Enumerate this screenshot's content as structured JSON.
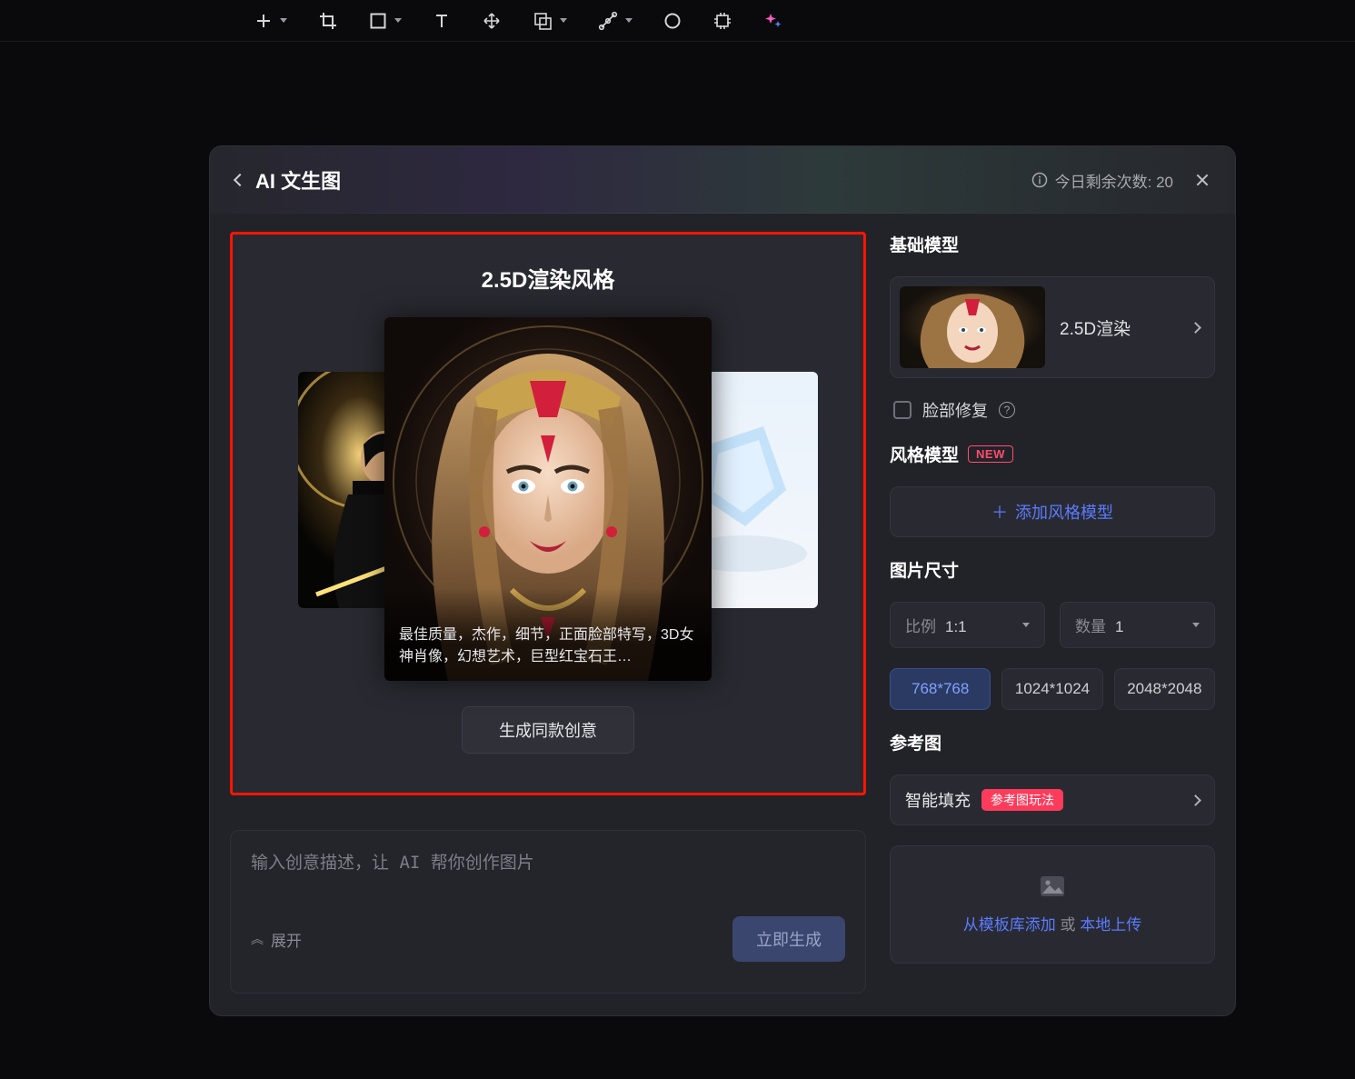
{
  "header": {
    "title": "AI 文生图",
    "quota": "今日剩余次数: 20"
  },
  "preview": {
    "title": "2.5D渲染风格",
    "caption": "最佳质量，杰作，细节，正面脸部特写，3D女神肖像，幻想艺术，巨型红宝石王…",
    "sameBtn": "生成同款创意"
  },
  "prompt": {
    "placeholder": "输入创意描述，让 AI 帮你创作图片",
    "expand": "展开",
    "generate": "立即生成"
  },
  "right": {
    "baseModel": {
      "title": "基础模型",
      "name": "2.5D渲染"
    },
    "faceRestore": "脸部修复",
    "styleModel": {
      "title": "风格模型",
      "badge": "NEW",
      "addBtn": "添加风格模型"
    },
    "size": {
      "title": "图片尺寸",
      "ratioLabel": "比例",
      "ratioValue": "1:1",
      "countLabel": "数量",
      "countValue": "1",
      "chips": [
        "768*768",
        "1024*1024",
        "2048*2048"
      ]
    },
    "ref": {
      "title": "参考图",
      "smart": "智能填充",
      "playPill": "参考图玩法",
      "fromTpl": "从模板库添加",
      "or": "或",
      "local": "本地上传"
    }
  }
}
